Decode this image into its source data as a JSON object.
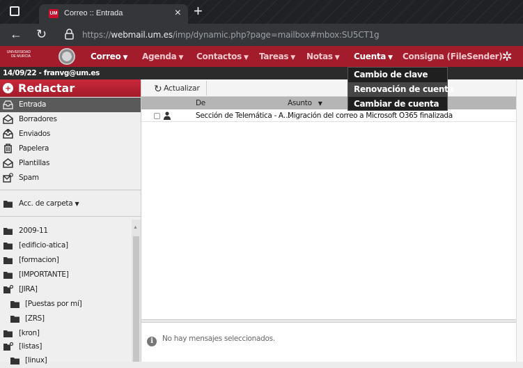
{
  "browser": {
    "tab_title": "Correo :: Entrada",
    "tab_favicon_text": "UM",
    "url_prefix": "https://",
    "url_host": "webmail.um.es",
    "url_path": "/imp/dynamic.php?page=mailbox#mbox:SU5CT1g"
  },
  "topmenu": {
    "logo_text": "UNIVERSIDAD DE MURCIA",
    "items": [
      {
        "label": "Correo"
      },
      {
        "label": "Agenda"
      },
      {
        "label": "Contactos"
      },
      {
        "label": "Tareas"
      },
      {
        "label": "Notas"
      },
      {
        "label": "Cuenta"
      },
      {
        "label": "Consigna (FileSender)"
      }
    ],
    "accent_color": "#a31c2b"
  },
  "userbar": {
    "text": "14/09/22 - franvg@um.es"
  },
  "cuenta_menu": {
    "items": [
      {
        "label": "Cambio de clave"
      },
      {
        "label": "Renovación de cuenta"
      },
      {
        "label": "Cambiar de cuenta"
      }
    ]
  },
  "sidebar": {
    "compose_label": "Redactar",
    "mailboxes": [
      {
        "label": "Entrada",
        "icon": "inbox-icon"
      },
      {
        "label": "Borradores",
        "icon": "drafts-icon"
      },
      {
        "label": "Enviados",
        "icon": "sent-icon"
      },
      {
        "label": "Papelera",
        "icon": "trash-icon"
      },
      {
        "label": "Plantillas",
        "icon": "templates-icon"
      },
      {
        "label": "Spam",
        "icon": "spam-icon"
      }
    ],
    "folder_actions_label": "Acc. de carpeta",
    "folders": [
      {
        "label": "2009-11"
      },
      {
        "label": "[edificio-atica]"
      },
      {
        "label": "[formacion]"
      },
      {
        "label": "[IMPORTANTE]"
      },
      {
        "label": "[JIRA]"
      },
      {
        "label": "[Puestas por mí]"
      },
      {
        "label": "[ZRS]"
      },
      {
        "label": "[kron]"
      },
      {
        "label": "[listas]"
      },
      {
        "label": "[linux]"
      }
    ]
  },
  "main": {
    "refresh_label": "Actualizar",
    "columns": {
      "from": "De",
      "subject": "Asunto"
    },
    "messages": [
      {
        "from": "Sección de Telemática - A…",
        "subject": "Migración del correo a Microsoft O365 finalizada"
      }
    ],
    "preview_empty": "No hay mensajes seleccionados."
  }
}
